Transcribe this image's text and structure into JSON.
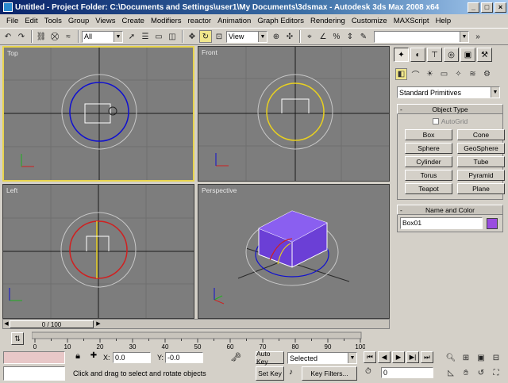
{
  "titlebar": {
    "title": "Untitled    - Project Folder: C:\\Documents and Settings\\user1\\My Documents\\3dsmax    - Autodesk 3ds Max 2008 x64",
    "minimize": "_",
    "maximize": "□",
    "close": "×"
  },
  "menu": [
    "File",
    "Edit",
    "Tools",
    "Group",
    "Views",
    "Create",
    "Modifiers",
    "reactor",
    "Animation",
    "Graph Editors",
    "Rendering",
    "Customize",
    "MAXScript",
    "Help"
  ],
  "toolbar": {
    "selection_filter": "All",
    "reference_coord": "View",
    "named_selection": ""
  },
  "viewports": {
    "top": "Top",
    "front": "Front",
    "left": "Left",
    "perspective": "Perspective"
  },
  "command_panel": {
    "category_dropdown": "Standard Primitives",
    "object_type_title": "Object Type",
    "autogrid": "AutoGrid",
    "primitives": [
      "Box",
      "Cone",
      "Sphere",
      "GeoSphere",
      "Cylinder",
      "Tube",
      "Torus",
      "Pyramid",
      "Teapot",
      "Plane"
    ],
    "name_color_title": "Name and Color",
    "object_name": "Box01",
    "object_color": "#9a4de0",
    "rollout_toggle": "-"
  },
  "timeline": {
    "frame_display": "0 / 100",
    "ticks": [
      "0",
      "10",
      "20",
      "30",
      "40",
      "50",
      "60",
      "70",
      "80",
      "90",
      "100"
    ]
  },
  "status": {
    "x_label": "X:",
    "x_value": "0.0",
    "y_label": "Y:",
    "y_value": "-0.0",
    "prompt": "Click and drag to select and rotate objects",
    "auto_key": "Auto Key",
    "set_key": "Set Key",
    "key_mode": "Selected",
    "key_filters": "Key Filters...",
    "current_frame": "0"
  },
  "colors": {
    "viewport_bg": "#7d7d7d",
    "active_border": "#e8d44d",
    "box_color": "#6b3fd6"
  }
}
